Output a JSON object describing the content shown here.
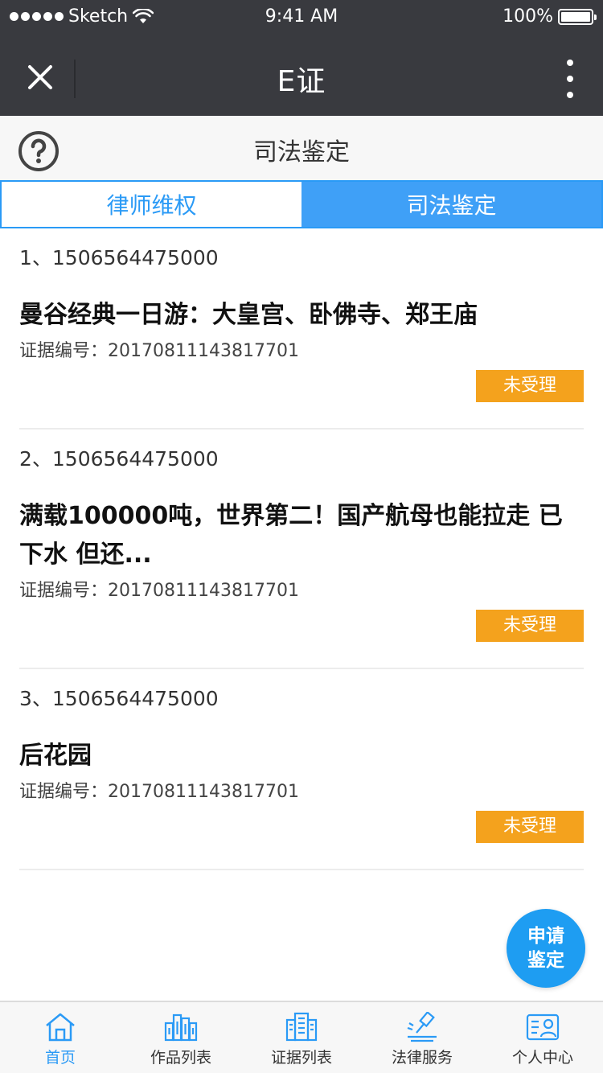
{
  "status_bar": {
    "carrier": "Sketch",
    "time": "9:41 AM",
    "battery": "100%"
  },
  "nav": {
    "title": "E证"
  },
  "page": {
    "title": "司法鉴定"
  },
  "tabs": [
    {
      "label": "律师维权",
      "active": false
    },
    {
      "label": "司法鉴定",
      "active": true
    }
  ],
  "items": [
    {
      "id": "1、1506564475000",
      "title": "曼谷经典一日游：大皇宫、卧佛寺、郑王庙",
      "evidence": "证据编号：20170811143817701",
      "status": "未受理"
    },
    {
      "id": "2、1506564475000",
      "title": "满载100000吨，世界第二！国产航母也能拉走 已下水 但还...",
      "evidence": "证据编号：20170811143817701",
      "status": "未受理"
    },
    {
      "id": "3、1506564475000",
      "title": "后花园",
      "evidence": "证据编号：20170811143817701",
      "status": "未受理"
    }
  ],
  "fab": {
    "line1": "申请",
    "line2": "鉴定"
  },
  "tabbar": [
    {
      "label": "首页",
      "icon": "home-icon",
      "active": true
    },
    {
      "label": "作品列表",
      "icon": "works-list-icon",
      "active": false
    },
    {
      "label": "证据列表",
      "icon": "evidence-list-icon",
      "active": false
    },
    {
      "label": "法律服务",
      "icon": "legal-service-icon",
      "active": false
    },
    {
      "label": "个人中心",
      "icon": "profile-icon",
      "active": false
    }
  ],
  "colors": {
    "primary": "#2a9af6",
    "status_badge": "#f4a21d",
    "nav_bg": "#393a3f"
  }
}
